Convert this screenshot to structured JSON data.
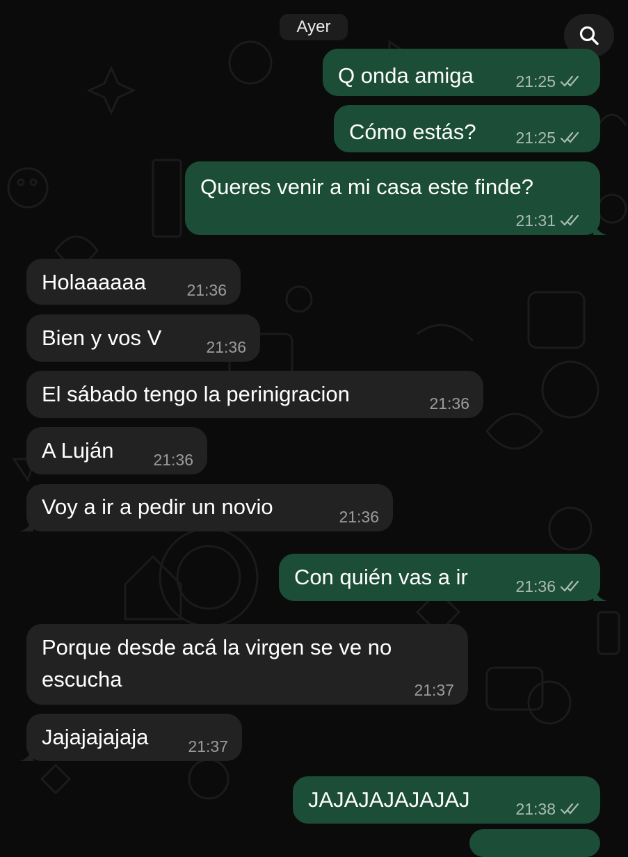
{
  "date_chip": "Ayer",
  "search_icon": "search-icon",
  "messages": [
    {
      "dir": "out",
      "text": "Q onda amiga",
      "time": "21:25",
      "status": "read-check-icon"
    },
    {
      "dir": "out",
      "text": "Cómo estás?",
      "time": "21:25",
      "status": "read-check-icon"
    },
    {
      "dir": "out",
      "text": "Queres venir a mi casa este finde?",
      "time": "21:31",
      "status": "read-check-icon"
    },
    {
      "dir": "in",
      "text": "Holaaaaaa",
      "time": "21:36"
    },
    {
      "dir": "in",
      "text": "Bien y vos V",
      "time": "21:36"
    },
    {
      "dir": "in",
      "text": "El sábado tengo la perinigracion",
      "time": "21:36"
    },
    {
      "dir": "in",
      "text": "A Luján",
      "time": "21:36"
    },
    {
      "dir": "in",
      "text": "Voy a ir a pedir un novio",
      "time": "21:36"
    },
    {
      "dir": "out",
      "text": "Con quién vas a ir",
      "time": "21:36",
      "status": "read-check-icon"
    },
    {
      "dir": "in",
      "text": "Porque desde acá la virgen se ve no",
      "text_line2": "escucha",
      "time": "21:37"
    },
    {
      "dir": "in",
      "text": "Jajajajajaja",
      "time": "21:37"
    },
    {
      "dir": "out",
      "text": "JAJAJAJAJAJAJ",
      "time": "21:38",
      "status": "read-check-icon"
    }
  ],
  "colors": {
    "background": "#0b0b0b",
    "outgoing_bubble": "#1c4d36",
    "incoming_bubble": "#222222",
    "date_chip": "#1d1d1d"
  }
}
